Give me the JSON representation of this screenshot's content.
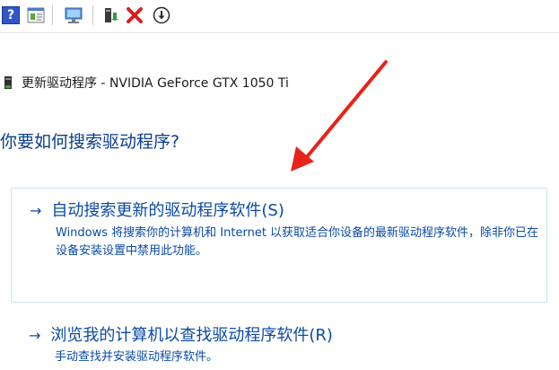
{
  "toolbar": {
    "items": [
      {
        "icon": "help-icon",
        "glyph": "?"
      },
      {
        "icon": "properties-icon"
      },
      {
        "icon": "scan-hardware-icon"
      },
      {
        "icon": "update-driver-icon"
      },
      {
        "icon": "uninstall-icon"
      },
      {
        "icon": "disable-device-icon"
      }
    ]
  },
  "dialog": {
    "device_title": "更新驱动程序 - NVIDIA GeForce GTX 1050 Ti",
    "question": "你要如何搜索驱动程序?",
    "options": [
      {
        "arrow": "→",
        "title": "自动搜索更新的驱动程序软件(S)",
        "description": "Windows 将搜索你的计算机和 Internet 以获取适合你设备的最新驱动程序软件，除非你已在设备安装设置中禁用此功能。"
      },
      {
        "arrow": "→",
        "title": "浏览我的计算机以查找驱动程序软件(R)",
        "description": "手动查找并安装驱动程序软件。"
      }
    ]
  },
  "colors": {
    "link_blue": "#0b4aa6",
    "heading_blue": "#0b3f8c",
    "annotation_red": "#e8231c",
    "option_border": "#cfe3f5"
  }
}
